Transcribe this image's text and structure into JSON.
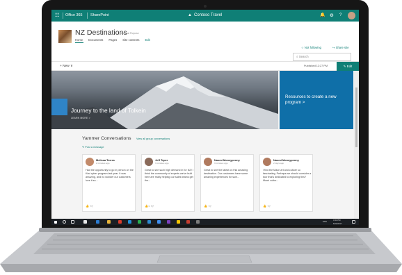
{
  "topbar": {
    "office": "Office 365",
    "app": "SharePoint",
    "brand": "Contoso Travel",
    "icons": [
      "bell-icon",
      "gear-icon",
      "help-icon"
    ]
  },
  "site": {
    "title": "NZ Destinations",
    "classification": "General Purpose",
    "nav": [
      "Home",
      "Documents",
      "Pages",
      "Site contents",
      "Edit"
    ],
    "follow": "Not following",
    "share": "Share site",
    "search_placeholder": "Search"
  },
  "commandbar": {
    "new": "New",
    "published": "Published 12:27 PM",
    "edit": "Edit"
  },
  "hero": {
    "title": "Journey to the land of Tolkein",
    "more": "LEARN MORE",
    "promo": "Resources to create a new program >"
  },
  "yammer": {
    "title": "Yammer Conversations",
    "link": "View all group conversations",
    "post": "Post a message",
    "cards": [
      {
        "name": "Melissa Torres",
        "time": "2 minutes ago",
        "text": "Had the opportunity to go in person on the Kiwi cyber program last year. It was amazing, and no wonder our customers love it so...",
        "foot": "",
        "color": "#c28a6a"
      },
      {
        "name": "Jeff Teper",
        "time": "3 minutes ago",
        "text": "Great to see such high demand in for NZ! I think the community of experts we've built here are really helping our sales teams get the...",
        "foot": "1",
        "color": "#8a6a5a"
      },
      {
        "name": "Naomi Moneypenny",
        "time": "3 minutes ago",
        "text": "Great to see the latest on this amazing destination. Our customers have some amazing experiences for sum...",
        "foot": "",
        "color": "#b07a5e"
      },
      {
        "name": "Naomi Moneypenny",
        "time": "2 days ago",
        "text": "I find the Maori art and culture so fascinating. Perhaps we should consider a tour that's dedicated to exploring this? Maori cultur...",
        "foot": "",
        "color": "#b07a5e"
      }
    ]
  },
  "taskbar": {
    "time": "3:41 PM",
    "date": "6/22/2017",
    "lang": "ENG"
  },
  "colors": {
    "accent": "#0f7f76",
    "promo": "#0f6fa8",
    "hero_tile": "#2f84c7"
  }
}
